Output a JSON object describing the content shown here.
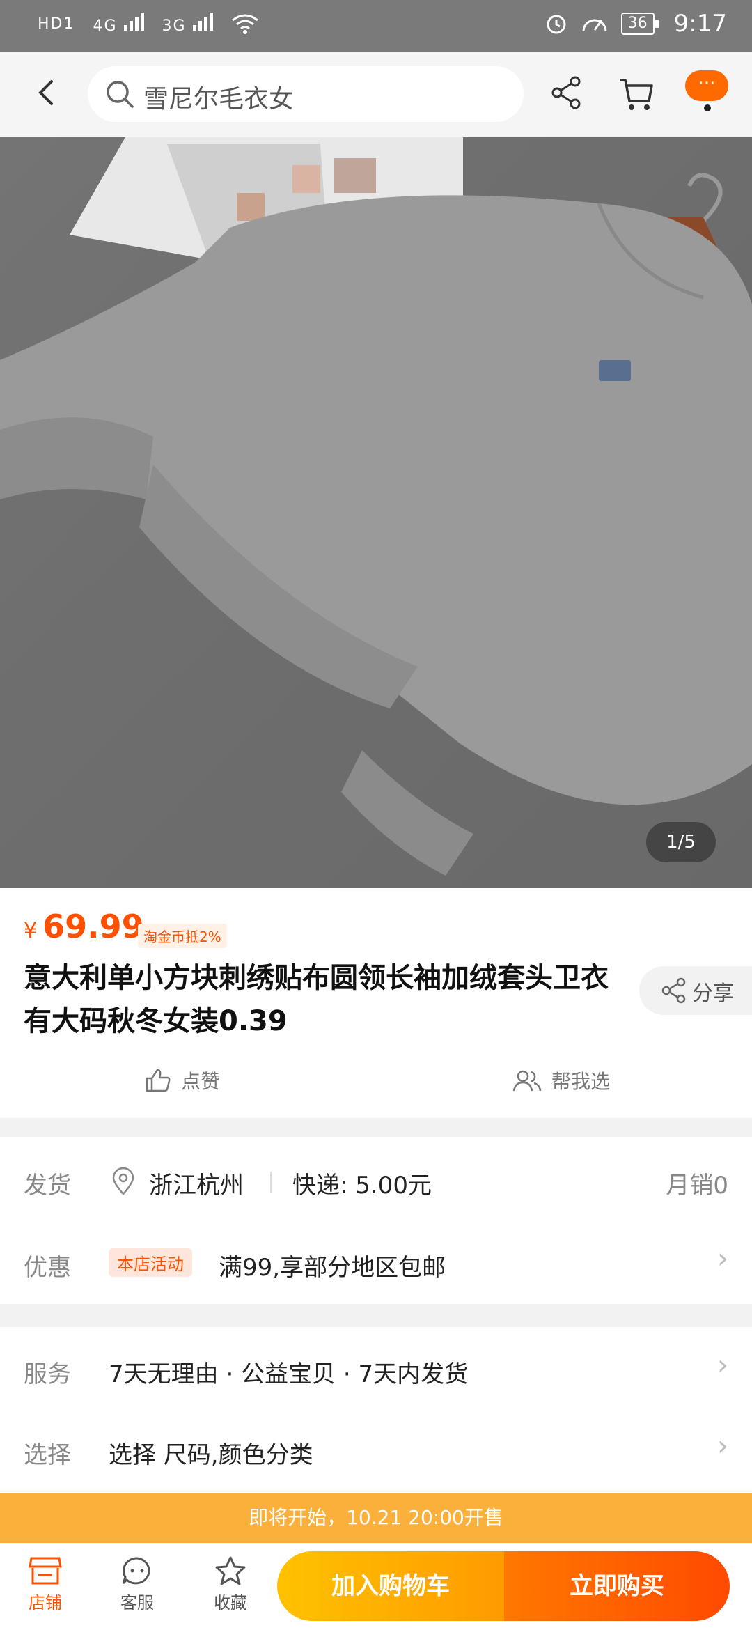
{
  "status_bar": {
    "left_indicators": [
      "HD1",
      "4G",
      "3G"
    ],
    "battery": "36",
    "time": "9:17"
  },
  "top_nav": {
    "search_placeholder": "雪尼尔毛衣女",
    "more_label": "···"
  },
  "image": {
    "counter": "1/5"
  },
  "product": {
    "currency": "¥",
    "price": "69.99",
    "coin_badge": "淘金币抵2%",
    "title": "意大利单小方块刺绣贴布圆领长袖加绒套头卫衣有大码秋冬女装0.39",
    "share_label": "分享",
    "like_label": "点赞",
    "help_label": "帮我选"
  },
  "shipping": {
    "label": "发货",
    "location": "浙江杭州",
    "fee": "快递: 5.00元",
    "monthly_sales": "月销0"
  },
  "promo": {
    "label": "优惠",
    "tag": "本店活动",
    "text": "满99,享部分地区包邮"
  },
  "service": {
    "label": "服务",
    "text": "7天无理由 · 公益宝贝 · 7天内发货"
  },
  "select": {
    "label": "选择",
    "text": "选择 尺码,颜色分类"
  },
  "presale_banner": "即将开始，10.21 20:00开售",
  "bottom_bar": {
    "store": "店铺",
    "service": "客服",
    "favorite": "收藏",
    "add_to_cart": "加入购物车",
    "buy_now": "立即购买"
  },
  "colors": {
    "accent": "#ff5000",
    "presale": "#fbb03b"
  }
}
